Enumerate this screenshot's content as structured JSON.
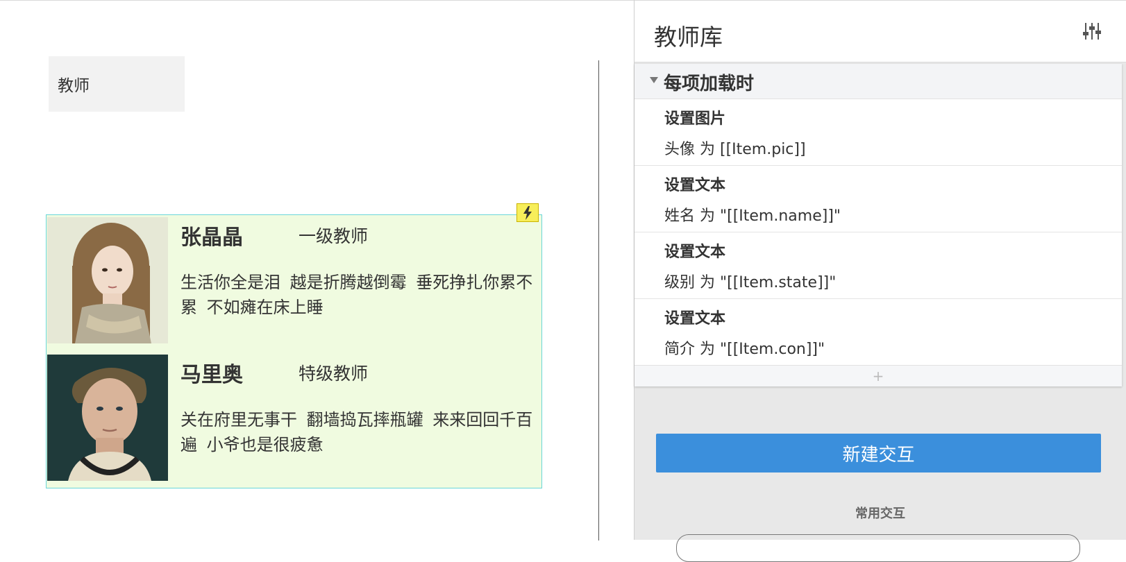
{
  "canvas": {
    "rectangle_label": "教师",
    "teachers": [
      {
        "name": "张晶晶",
        "level": "一级教师",
        "bio": "生活你全是泪 越是折腾越倒霉 垂死挣扎你累不累 不如瘫在床上睡"
      },
      {
        "name": "马里奥",
        "level": "特级教师",
        "bio": "关在府里无事干 翻墙捣瓦摔瓶罐 来来回回千百遍 小爷也是很疲惫"
      }
    ]
  },
  "panel": {
    "title": "教师库",
    "settings_icon": "sliders-icon",
    "event": {
      "title": "每项加载时",
      "actions": [
        {
          "title": "设置图片",
          "desc": "头像 为 [[Item.pic]]"
        },
        {
          "title": "设置文本",
          "desc": "姓名 为 \"[[Item.name]]\""
        },
        {
          "title": "设置文本",
          "desc": "级别 为 \"[[Item.state]]\""
        },
        {
          "title": "设置文本",
          "desc": "简介 为 \"[[Item.con]]\""
        }
      ],
      "add_label": "+"
    },
    "new_interaction_label": "新建交互",
    "common_label": "常用交互"
  },
  "colors": {
    "repeater_bg": "#f0fbe0",
    "repeater_border": "#6ad6d9",
    "primary_button": "#3b8fdc",
    "lightning_badge": "#f7ee5a"
  }
}
